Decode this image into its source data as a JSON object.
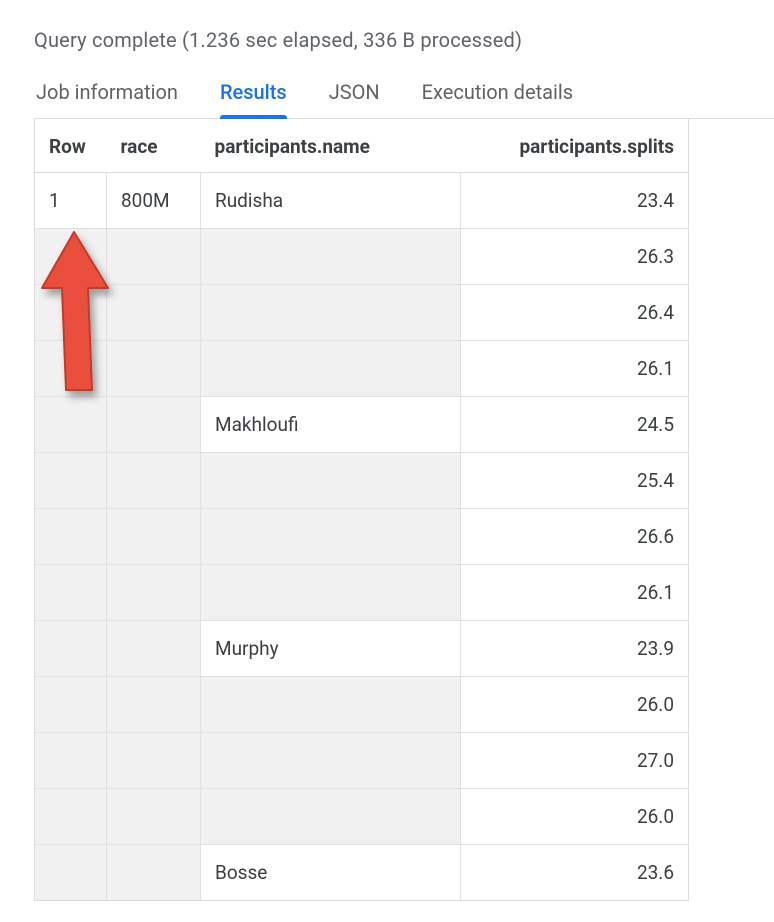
{
  "status_text": "Query complete (1.236 sec elapsed, 336 B processed)",
  "tabs": {
    "job_info": "Job information",
    "results": "Results",
    "json": "JSON",
    "execution": "Execution details"
  },
  "columns": {
    "row": "Row",
    "race": "race",
    "name": "participants.name",
    "splits": "participants.splits"
  },
  "rows": [
    {
      "row": "1",
      "race": "800M",
      "name": "Rudisha",
      "split": "23.4",
      "rg": false,
      "cg": false,
      "ng": false
    },
    {
      "row": "",
      "race": "",
      "name": "",
      "split": "26.3",
      "rg": true,
      "cg": true,
      "ng": true
    },
    {
      "row": "",
      "race": "",
      "name": "",
      "split": "26.4",
      "rg": true,
      "cg": true,
      "ng": true
    },
    {
      "row": "",
      "race": "",
      "name": "",
      "split": "26.1",
      "rg": true,
      "cg": true,
      "ng": true
    },
    {
      "row": "",
      "race": "",
      "name": "Makhloufi",
      "split": "24.5",
      "rg": true,
      "cg": true,
      "ng": false
    },
    {
      "row": "",
      "race": "",
      "name": "",
      "split": "25.4",
      "rg": true,
      "cg": true,
      "ng": true
    },
    {
      "row": "",
      "race": "",
      "name": "",
      "split": "26.6",
      "rg": true,
      "cg": true,
      "ng": true
    },
    {
      "row": "",
      "race": "",
      "name": "",
      "split": "26.1",
      "rg": true,
      "cg": true,
      "ng": true
    },
    {
      "row": "",
      "race": "",
      "name": "Murphy",
      "split": "23.9",
      "rg": true,
      "cg": true,
      "ng": false
    },
    {
      "row": "",
      "race": "",
      "name": "",
      "split": "26.0",
      "rg": true,
      "cg": true,
      "ng": true
    },
    {
      "row": "",
      "race": "",
      "name": "",
      "split": "27.0",
      "rg": true,
      "cg": true,
      "ng": true
    },
    {
      "row": "",
      "race": "",
      "name": "",
      "split": "26.0",
      "rg": true,
      "cg": true,
      "ng": true
    },
    {
      "row": "",
      "race": "",
      "name": "Bosse",
      "split": "23.6",
      "rg": true,
      "cg": true,
      "ng": false
    }
  ]
}
